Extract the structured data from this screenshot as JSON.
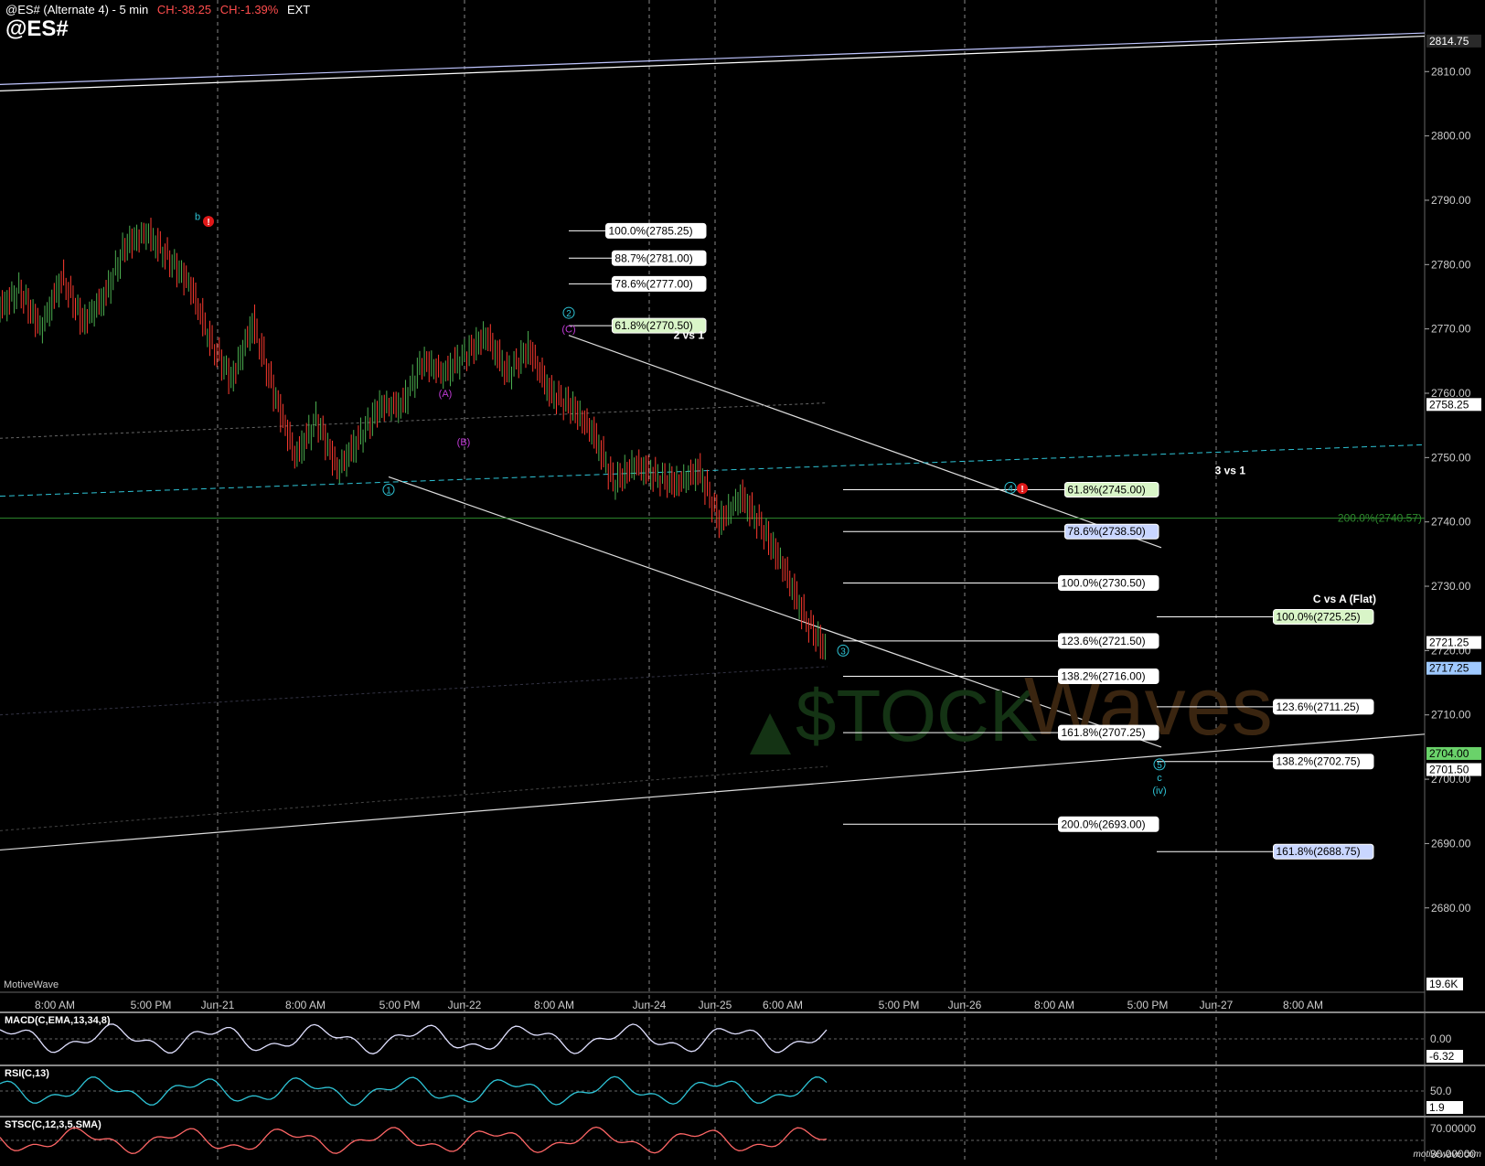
{
  "header": {
    "title": "@ES# (Alternate 4) - 5 min",
    "change_points": "CH:-38.25",
    "change_pct": "CH:-1.39%",
    "session": "EXT",
    "symbol": "@ES#"
  },
  "footer": {
    "provider": "MotiveWave",
    "watermark": "motivewave.com"
  },
  "colors": {
    "background": "#000000",
    "up_candle": "#4caf50",
    "down_candle": "#ff3b30",
    "wave_cyan": "#2ec4d6",
    "wave_magenta": "#c03ad6",
    "fib_line": "#ffffff",
    "grid": "#777777"
  },
  "chart_data": [
    {
      "type": "candlestick",
      "title": "@ES# (Alternate 4) - 5 min",
      "ylim": [
        2673,
        2818
      ],
      "y_ticks": [
        2680,
        2690,
        2700,
        2710,
        2720,
        2730,
        2740,
        2750,
        2760,
        2770,
        2780,
        2790,
        2800,
        2810
      ],
      "y_tick_labels": [
        "2680.00",
        "2690.00",
        "2700.00",
        "2710.00",
        "2720.00",
        "2730.00",
        "2740.00",
        "2750.00",
        "2760.00",
        "2770.00",
        "2780.00",
        "2790.00",
        "2800.00",
        "2810.00"
      ],
      "x_tick_labels": [
        "8:00 AM",
        "5:00 PM",
        "Jun-21",
        "8:00 AM",
        "5:00 PM",
        "Jun-22",
        "8:00 AM",
        "Jun-24",
        "Jun-25",
        "6:00 AM",
        "5:00 PM",
        "Jun-26",
        "8:00 AM",
        "5:00 PM",
        "Jun-27",
        "8:00 AM"
      ],
      "price_path": [
        2773,
        2776,
        2770,
        2778,
        2771,
        2775,
        2783,
        2785,
        2781,
        2777,
        2768,
        2762,
        2771,
        2760,
        2750,
        2756,
        2748,
        2753,
        2758,
        2758,
        2765,
        2763,
        2766,
        2769,
        2763,
        2767,
        2760,
        2758,
        2754,
        2746,
        2749,
        2747,
        2746,
        2748,
        2740,
        2744,
        2739,
        2733,
        2725,
        2720
      ],
      "price_labels": [
        {
          "text": "2814.75",
          "value": 2814.75,
          "bg": "#2a2a2a",
          "color": "#ffffff"
        },
        {
          "text": "2758.25",
          "value": 2758.25,
          "bg": "#ffffff",
          "color": "#000000"
        },
        {
          "text": "2721.25",
          "value": 2721.25,
          "bg": "#ffffff",
          "color": "#000000"
        },
        {
          "text": "2717.25",
          "value": 2717.25,
          "bg": "#9fc9ff",
          "color": "#000000"
        },
        {
          "text": "2704.00",
          "value": 2704.0,
          "bg": "#6ad26a",
          "color": "#000000"
        },
        {
          "text": "2701.50",
          "value": 2701.5,
          "bg": "#ffffff",
          "color": "#000000"
        }
      ],
      "fib_levels": [
        {
          "label": "100.0%(2785.25)",
          "value": 2785.25,
          "col": "a",
          "bg": "#ffffff"
        },
        {
          "label": "88.7%(2781.00)",
          "value": 2781.0,
          "col": "a",
          "bg": "#ffffff"
        },
        {
          "label": "78.6%(2777.00)",
          "value": 2777.0,
          "col": "a",
          "bg": "#ffffff"
        },
        {
          "label": "61.8%(2770.50)",
          "value": 2770.5,
          "col": "a",
          "bg": "#d9f5c8"
        },
        {
          "label": "61.8%(2745.00)",
          "value": 2745.0,
          "col": "b",
          "bg": "#d9f5c8"
        },
        {
          "label": "78.6%(2738.50)",
          "value": 2738.5,
          "col": "b",
          "bg": "#c9d6ff"
        },
        {
          "label": "100.0%(2730.50)",
          "value": 2730.5,
          "col": "b",
          "bg": "#ffffff"
        },
        {
          "label": "123.6%(2721.50)",
          "value": 2721.5,
          "col": "b",
          "bg": "#ffffff"
        },
        {
          "label": "138.2%(2716.00)",
          "value": 2716.0,
          "col": "b",
          "bg": "#ffffff"
        },
        {
          "label": "161.8%(2707.25)",
          "value": 2707.25,
          "col": "b",
          "bg": "#ffffff"
        },
        {
          "label": "200.0%(2693.00)",
          "value": 2693.0,
          "col": "b",
          "bg": "#ffffff"
        },
        {
          "label": "100.0%(2725.25)",
          "value": 2725.25,
          "col": "c",
          "bg": "#d9f5c8"
        },
        {
          "label": "123.6%(2711.25)",
          "value": 2711.25,
          "col": "c",
          "bg": "#ffffff"
        },
        {
          "label": "138.2%(2702.75)",
          "value": 2702.75,
          "col": "c",
          "bg": "#ffffff"
        },
        {
          "label": "161.8%(2688.75)",
          "value": 2688.75,
          "col": "c",
          "bg": "#c9d6ff"
        }
      ],
      "annotations": [
        {
          "text": "2 vs 1",
          "value": 2769.0,
          "col": "a"
        },
        {
          "text": "3 vs 1",
          "value": 2748.0,
          "col": "b"
        },
        {
          "text": "C vs A (Flat)",
          "value": 2728.0,
          "col": "c"
        },
        {
          "text": "200.0%(2740.57)",
          "value": 2740.57,
          "col": "d"
        }
      ],
      "wave_labels": [
        {
          "text": "b",
          "value": 2787.5,
          "pos": "b",
          "color": "#2ec4d6"
        },
        {
          "text": "2",
          "value": 2772.5,
          "pos": "w2",
          "color": "#2ec4d6",
          "circled": true
        },
        {
          "text": "(C)",
          "value": 2770.0,
          "pos": "w2",
          "color": "#c03ad6"
        },
        {
          "text": "(A)",
          "value": 2760.0,
          "pos": "wA",
          "color": "#c03ad6"
        },
        {
          "text": "(B)",
          "value": 2752.5,
          "pos": "wB",
          "color": "#c03ad6"
        },
        {
          "text": "1",
          "value": 2745.0,
          "pos": "w1",
          "color": "#2ec4d6",
          "circled": true
        },
        {
          "text": "4",
          "value": 2745.3,
          "pos": "w4",
          "color": "#2ec4d6",
          "circled": true
        },
        {
          "text": "3",
          "value": 2720.0,
          "pos": "w3",
          "color": "#2ec4d6",
          "circled": true
        },
        {
          "text": "5",
          "value": 2702.3,
          "pos": "w5",
          "color": "#2ec4d6",
          "circled": true
        },
        {
          "text": "c",
          "value": 2700.3,
          "pos": "w5",
          "color": "#2ec4d6"
        },
        {
          "text": "(iv)",
          "value": 2698.3,
          "pos": "w5",
          "color": "#2ec4d6"
        }
      ],
      "volume_label": "19.6K"
    },
    {
      "type": "line",
      "title": "MACD(C,EMA,13,34,8)",
      "y_tick_labels": [
        "0.00"
      ],
      "last_value": "-6.32"
    },
    {
      "type": "line",
      "title": "RSI(C,13)",
      "y_tick_labels": [
        "50.0"
      ],
      "last_value": "1.9"
    },
    {
      "type": "line",
      "title": "STSC(C,12,3,5,SMA)",
      "y_tick_labels": [
        "70.00000",
        "30.00000"
      ]
    }
  ]
}
